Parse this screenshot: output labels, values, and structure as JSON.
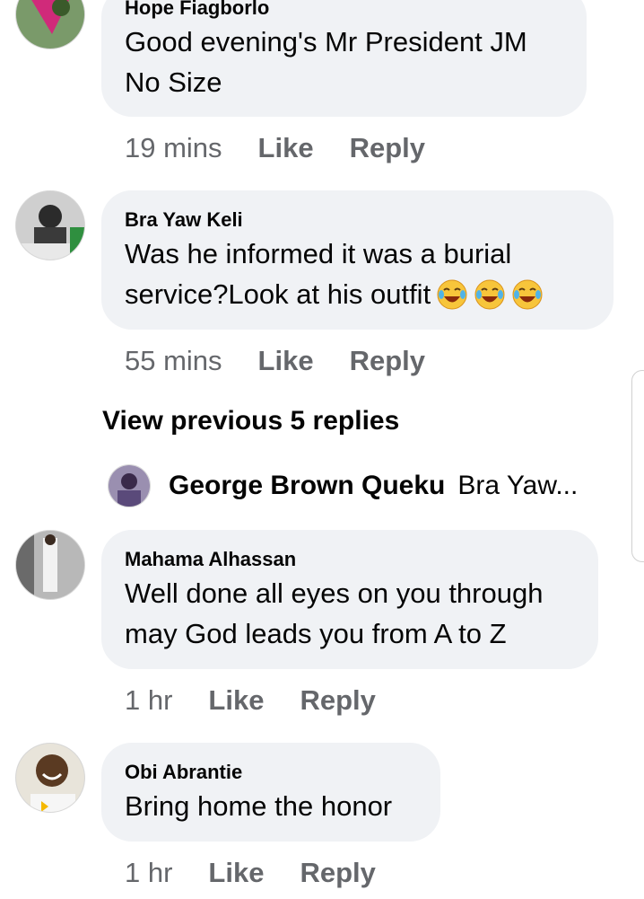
{
  "comments": [
    {
      "author": "Hope Fiagborlo",
      "line1": "Good evening's Mr President JM",
      "line2": "No Size",
      "time": "19 mins",
      "like": "Like",
      "reply": "Reply"
    },
    {
      "author": "Bra Yaw Keli",
      "line1": "Was he informed it was a burial",
      "line2": "service?Look at his outfit",
      "time": "55 mins",
      "like": "Like",
      "reply": "Reply",
      "emoji": [
        "face-with-tears-of-joy",
        "face-with-tears-of-joy",
        "face-with-tears-of-joy"
      ]
    },
    {
      "author": "Mahama Alhassan",
      "line1": "Well done all eyes on you through",
      "line2": "may God leads you from A to Z",
      "time": "1 hr",
      "like": "Like",
      "reply": "Reply"
    },
    {
      "author": "Obi Abrantie",
      "line1": "Bring home the honor",
      "time": "1 hr",
      "like": "Like",
      "reply": "Reply"
    }
  ],
  "view_previous": "View previous 5 replies",
  "reply_preview": {
    "name": "George Brown Queku",
    "snippet": "Bra Yaw..."
  },
  "colors": {
    "bubble": "#f0f2f5",
    "meta": "#65676b",
    "text": "#050505"
  }
}
